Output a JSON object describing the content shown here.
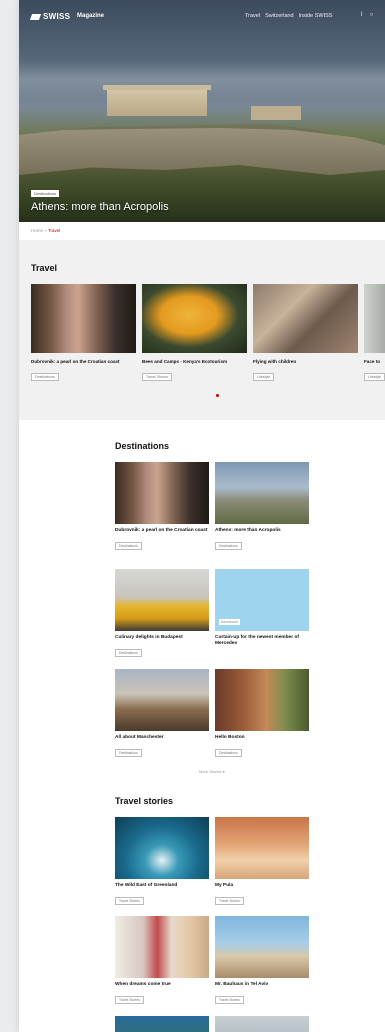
{
  "header": {
    "logo": "SWISS",
    "magazine": "Magazine",
    "nav": [
      "Travel",
      "Switzerland",
      "Inside SWISS"
    ]
  },
  "hero": {
    "badge": "Destinations",
    "title": "Athens: more than Acropolis"
  },
  "breadcrumb": {
    "home": "Home",
    "separator": "»",
    "current": "Travel"
  },
  "travel": {
    "title": "Travel",
    "cards": [
      {
        "title": "Dubrovnik: a pearl on the Croatian coast",
        "tag": "Destinations"
      },
      {
        "title": "Bees and Camps - Kenya's Ecotourism",
        "tag": "Travel Stories"
      },
      {
        "title": "Flying with children",
        "tag": "Lifestyle"
      },
      {
        "title": "Face to",
        "tag": "Lifestyle"
      }
    ]
  },
  "destinations": {
    "title": "Destinations",
    "cards": [
      {
        "title": "Dubrovnik: a pearl on the Croatian coast",
        "tag": "Destinations"
      },
      {
        "title": "Athens: more than Acropolis",
        "tag": "Destinations"
      },
      {
        "title": "Culinary delights in Budapest",
        "tag": "Destinations"
      },
      {
        "title": "Curtain-up for the newest member of Mercedes",
        "tag": "Advertorial"
      },
      {
        "title": "All about Manchester",
        "tag": "Destinations"
      },
      {
        "title": "Hello Boston",
        "tag": "Destinations"
      }
    ],
    "more": "More Stories ▾"
  },
  "travel_stories": {
    "title": "Travel stories",
    "cards": [
      {
        "title": "The Wild East of Greenland",
        "tag": "Travel Stories"
      },
      {
        "title": "My Pula",
        "tag": "Travel Stories"
      },
      {
        "title": "When dreams come true",
        "tag": "Travel Stories"
      },
      {
        "title": "Mr. Bauhaus in Tel Aviv",
        "tag": "Travel Stories"
      }
    ]
  },
  "colors": {
    "accent": "#cc0000",
    "panel": "#f1f1f1"
  }
}
